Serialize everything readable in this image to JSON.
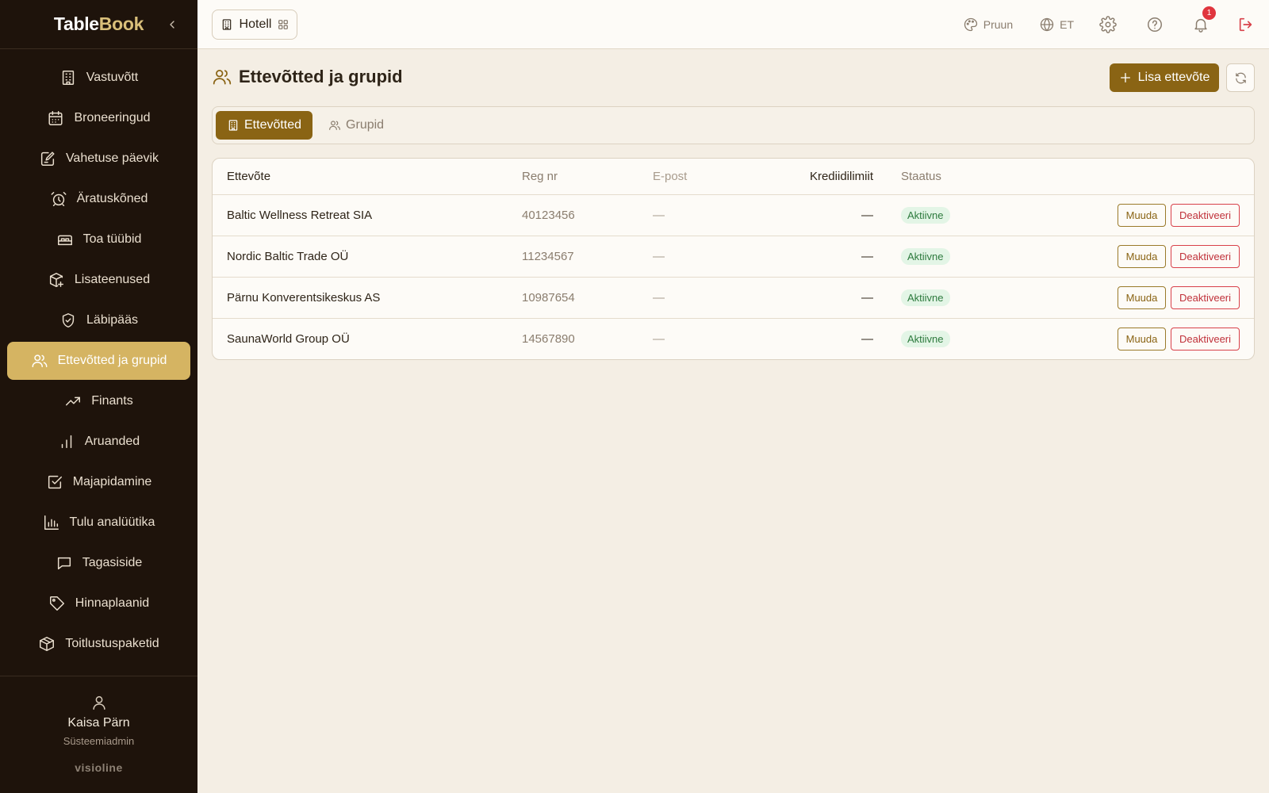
{
  "brand": {
    "part1": "Table",
    "part2": "Book"
  },
  "sidebar": {
    "items": [
      {
        "label": "Vastuvõtt",
        "icon": "building-icon"
      },
      {
        "label": "Broneeringud",
        "icon": "calendar-icon"
      },
      {
        "label": "Vahetuse päevik",
        "icon": "edit-note-icon"
      },
      {
        "label": "Äratuskõned",
        "icon": "alarm-clock-icon"
      },
      {
        "label": "Toa tüübid",
        "icon": "bed-icon"
      },
      {
        "label": "Lisateenused",
        "icon": "package-plus-icon"
      },
      {
        "label": "Läbipääs",
        "icon": "shield-check-icon"
      },
      {
        "label": "Ettevõtted ja grupid",
        "icon": "users-icon",
        "active": true
      },
      {
        "label": "Finants",
        "icon": "trending-up-icon"
      },
      {
        "label": "Aruanded",
        "icon": "bar-chart-icon"
      },
      {
        "label": "Majapidamine",
        "icon": "check-square-icon"
      },
      {
        "label": "Tulu analüütika",
        "icon": "chart-icon"
      },
      {
        "label": "Tagasiside",
        "icon": "message-icon"
      },
      {
        "label": "Hinnaplaanid",
        "icon": "tag-icon"
      },
      {
        "label": "Toitlustuspaketid",
        "icon": "box-icon"
      }
    ],
    "user": {
      "name": "Kaisa Pärn",
      "role": "Süsteemiadmin"
    },
    "footer_brand": "visioline"
  },
  "topbar": {
    "hotel_label": "Hotell",
    "theme_label": "Pruun",
    "lang_label": "ET",
    "notification_count": "1"
  },
  "page": {
    "title": "Ettevõtted ja grupid",
    "add_button": "Lisa ettevõte",
    "tabs": [
      {
        "label": "Ettevõtted",
        "active": true
      },
      {
        "label": "Grupid",
        "active": false
      }
    ]
  },
  "table": {
    "columns": [
      "Ettevõte",
      "Reg nr",
      "E-post",
      "Krediidilimiit",
      "Staatus"
    ],
    "rows": [
      {
        "name": "Baltic Wellness Retreat SIA",
        "reg": "40123456",
        "email": "—",
        "limit": "—",
        "status": "Aktiivne"
      },
      {
        "name": "Nordic Baltic Trade OÜ",
        "reg": "11234567",
        "email": "—",
        "limit": "—",
        "status": "Aktiivne"
      },
      {
        "name": "Pärnu Konverentsikeskus AS",
        "reg": "10987654",
        "email": "—",
        "limit": "—",
        "status": "Aktiivne"
      },
      {
        "name": "SaunaWorld Group OÜ",
        "reg": "14567890",
        "email": "—",
        "limit": "—",
        "status": "Aktiivne"
      }
    ],
    "edit_label": "Muuda",
    "deactivate_label": "Deaktiveeri"
  },
  "colors": {
    "sidebar_bg": "#1e130b",
    "active_nav": "#d5b462",
    "accent": "#8a6414",
    "danger": "#d8414a",
    "status_bg": "#e3f5e6"
  }
}
